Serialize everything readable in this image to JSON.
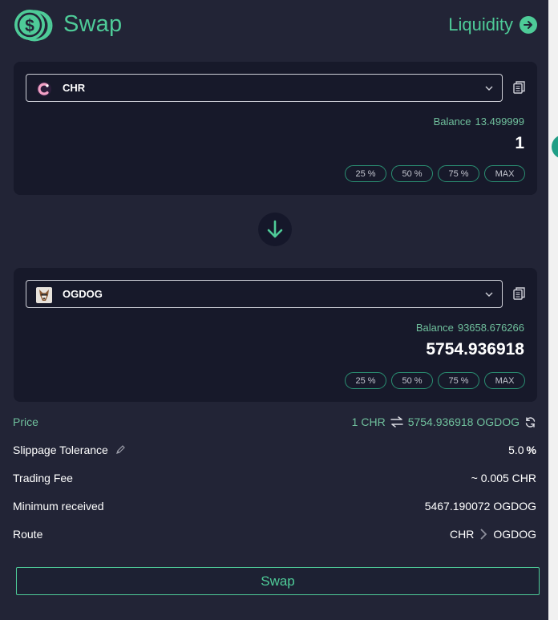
{
  "header": {
    "title": "Swap",
    "liquidity_label": "Liquidity"
  },
  "from": {
    "token": "CHR",
    "token_icon": "chromia-icon",
    "balance_label": "Balance",
    "balance_value": "13.499999",
    "amount": "1",
    "percent_buttons": [
      "25 %",
      "50 %",
      "75 %",
      "MAX"
    ]
  },
  "to": {
    "token": "OGDOG",
    "token_icon": "dog-avatar-icon",
    "balance_label": "Balance",
    "balance_value": "93658.676266",
    "amount": "5754.936918",
    "percent_buttons": [
      "25 %",
      "50 %",
      "75 %",
      "MAX"
    ]
  },
  "info": {
    "price_label": "Price",
    "price_left": "1 CHR",
    "price_right": "5754.936918 OGDOG",
    "slippage_label": "Slippage Tolerance",
    "slippage_value": "5.0",
    "slippage_unit": "%",
    "fee_label": "Trading Fee",
    "fee_value": "~ 0.005 CHR",
    "min_label": "Minimum received",
    "min_value": "5467.190072 OGDOG",
    "route_label": "Route",
    "route_from": "CHR",
    "route_to": "OGDOG"
  },
  "swap_button": "Swap",
  "colors": {
    "background": "#222436",
    "panel": "#17192a",
    "accent": "#4ecb98",
    "muted_green": "#6fbf9c"
  }
}
